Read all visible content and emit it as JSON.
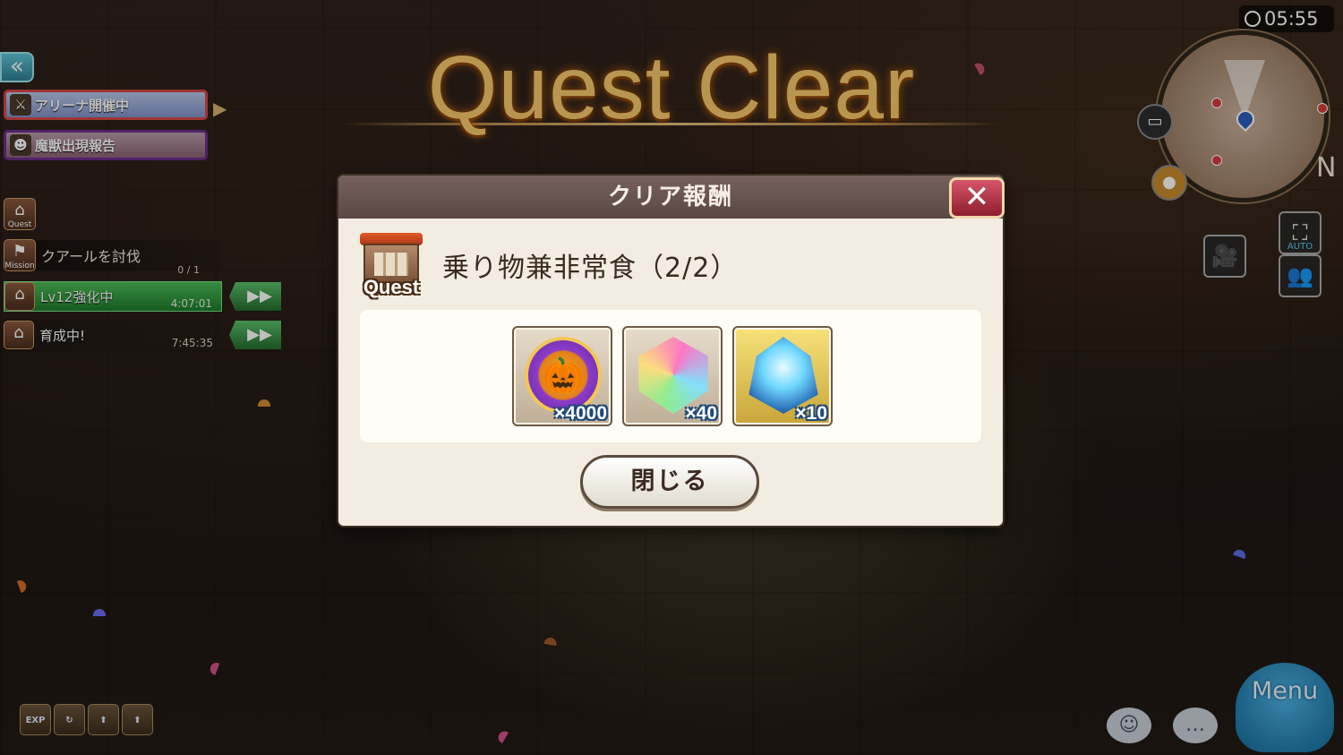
{
  "title": "Quest Clear",
  "clock": "05:55",
  "left_hud": {
    "back_button": "«",
    "arena_banner": "アリーナ開催中",
    "monster_banner": "魔獣出現報告",
    "quest_icon_caption": "Quest",
    "mission_icon_caption": "Mission",
    "mission_text": "クアールを討伐",
    "mission_count": "0 / 1",
    "status_items": [
      {
        "label": "Lv12強化中",
        "time": "4:07:01"
      },
      {
        "label": "育成中!",
        "time": "7:45:35"
      }
    ],
    "fast_forward": "▶▶",
    "bottom_icons": [
      "EXP",
      "↻",
      "⬆",
      "⬆"
    ]
  },
  "right_hud": {
    "north_label": "N",
    "auto_label": "AUTO",
    "menu_label": "Menu"
  },
  "dialog": {
    "header": "クリア報酬",
    "close_x": "✕",
    "quest_badge": "Quest",
    "quest_name": "乗り物兼非常食（2/2）",
    "rewards": [
      {
        "name": "pumpkin-coin",
        "quantity": "×4000"
      },
      {
        "name": "rainbow-crystal",
        "quantity": "×40"
      },
      {
        "name": "blue-flame-ore",
        "quantity": "×10"
      }
    ],
    "close_button": "閉じる"
  },
  "colors": {
    "title_gold": "#f7c86a",
    "dialog_bg": "#f2ede0",
    "header_bg": "#5a4840",
    "close_red": "#c0364a",
    "status_green": "#1f7a2b"
  }
}
